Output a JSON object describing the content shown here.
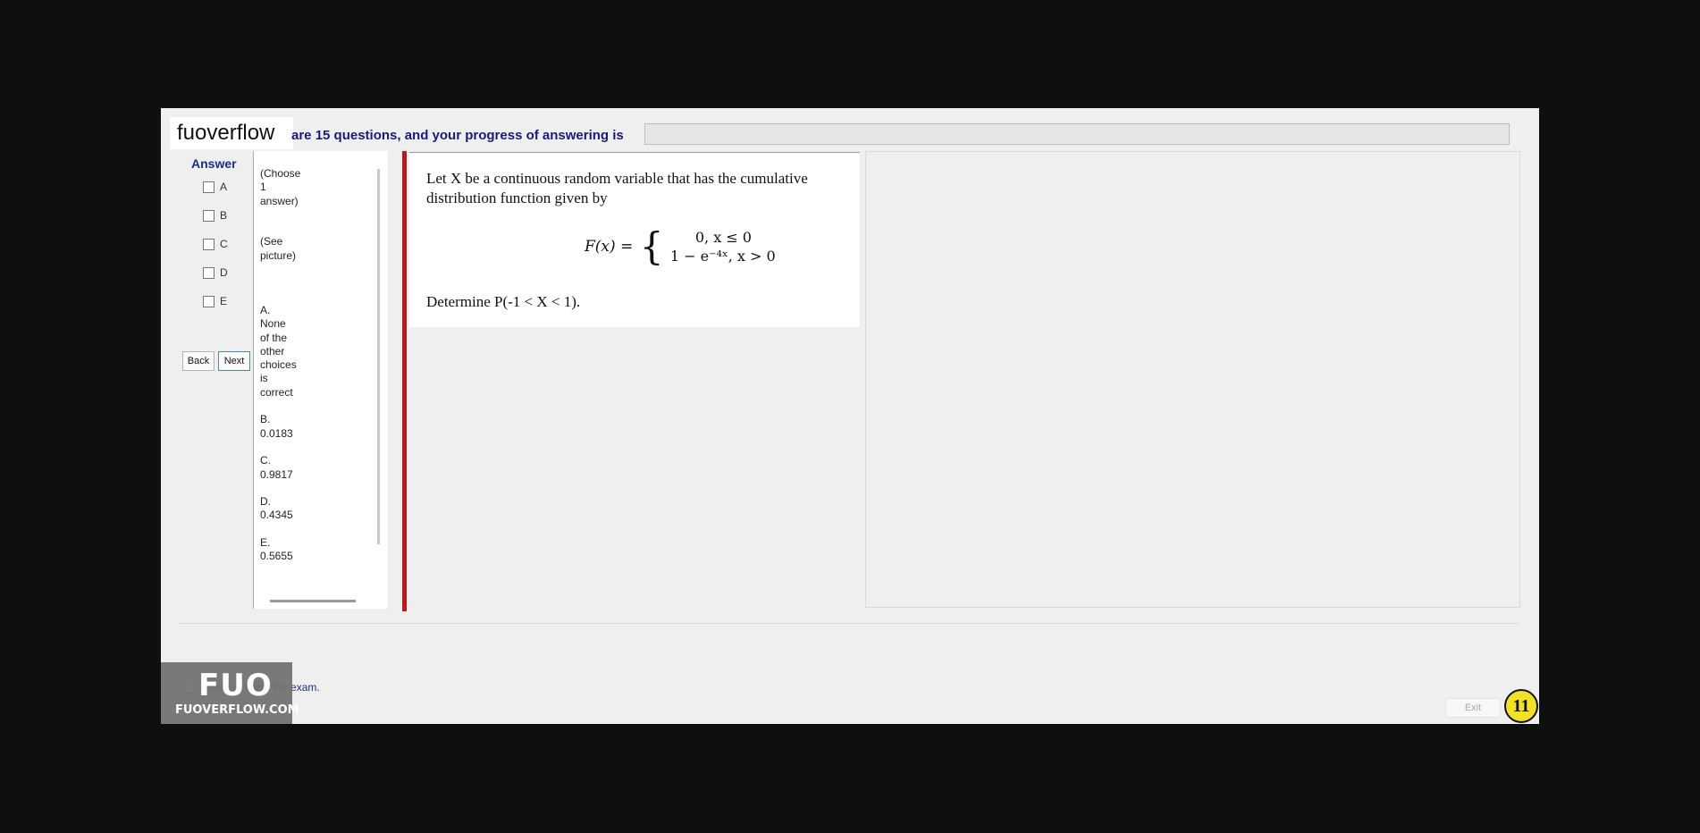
{
  "brand": "fuoverflow",
  "header_text": "are 15 questions, and your progress of answering is",
  "answer": {
    "title": "Answer",
    "options": [
      "A",
      "B",
      "C",
      "D",
      "E"
    ]
  },
  "nav": {
    "back": "Back",
    "next": "Next"
  },
  "choices_text": "(Choose\n1\nanswer)\n\n\n(See\npicture)\n\n\n\nA.\nNone\nof the\nother\nchoices\nis\ncorrect\n\nB.\n0.0183\n\nC.\n0.9817\n\nD.\n0.4345\n\nE.\n0.5655",
  "question": {
    "intro": "Let X be a continuous random variable that has the cumulative distribution function given by",
    "formula_lhs": "F(x) =",
    "case1": "0, x ≤ 0",
    "case2": "1 − e⁻⁴ˣ, x > 0",
    "prompt": "Determine P(-1 < X < 1)."
  },
  "finish_label": "I want to finish the exam.",
  "logo": {
    "big": "FUO",
    "small": "FUOVERFLOW.COM"
  },
  "exit": "Exit",
  "timer": "11"
}
